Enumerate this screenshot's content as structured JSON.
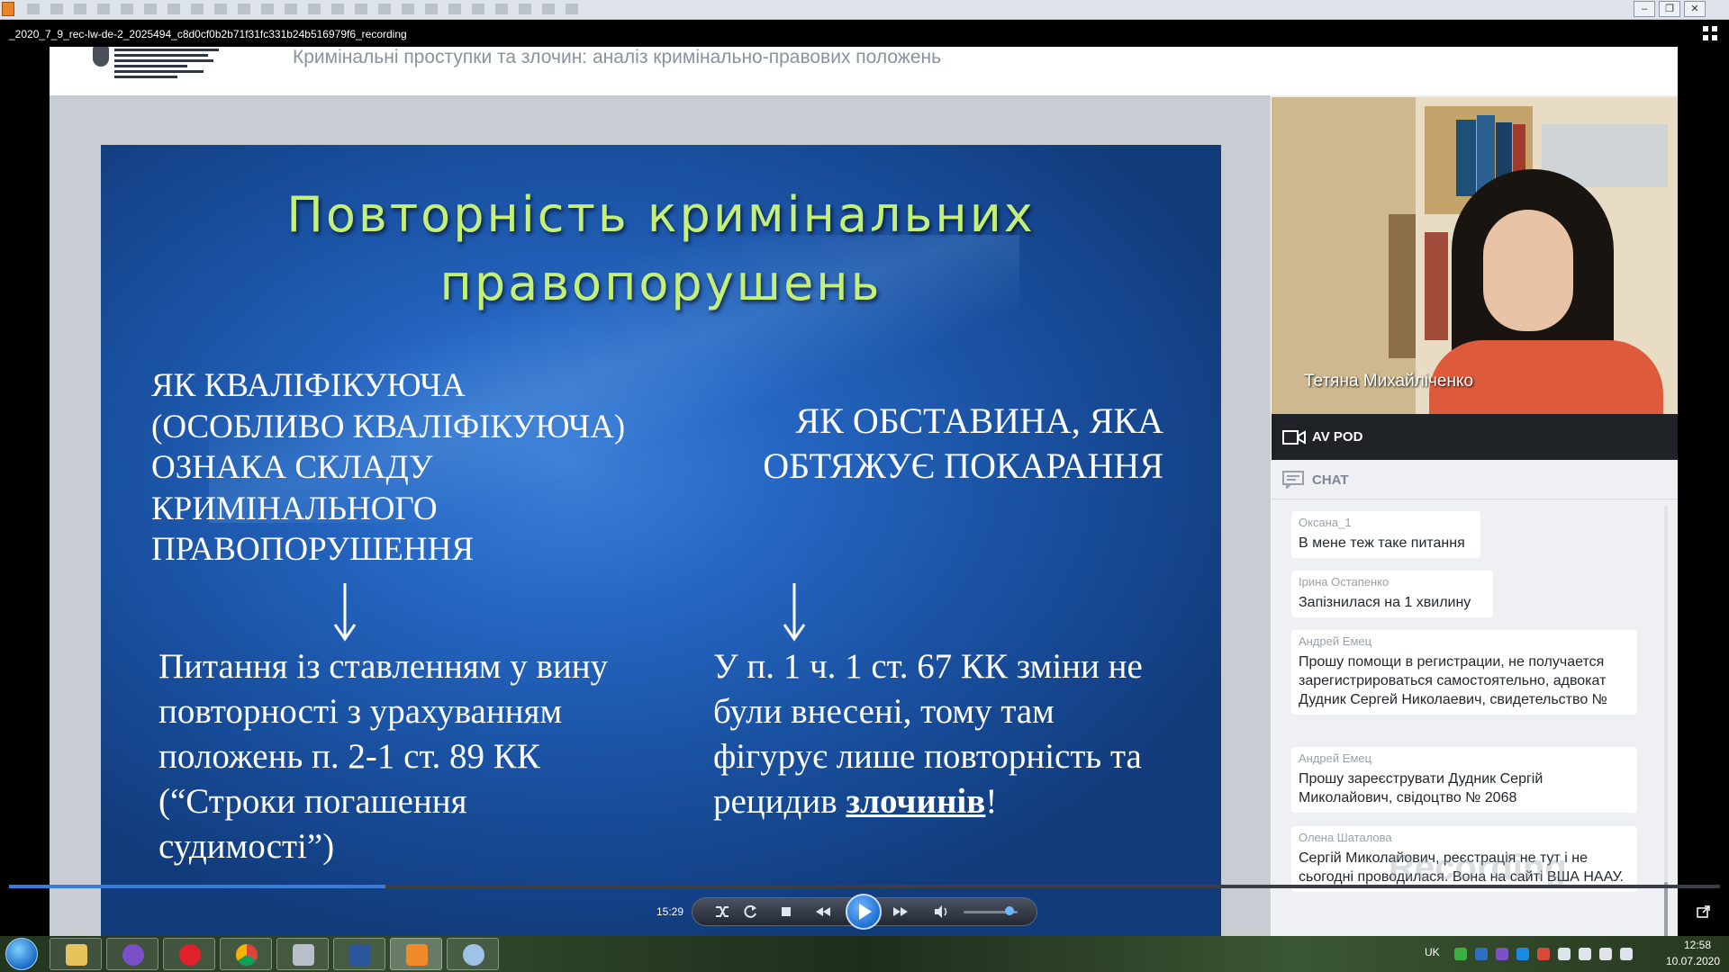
{
  "window": {
    "title": "_2020_7_9_rec-lw-de-2_2025494_c8d0cf0b2b71f31fc331b24b516979f6_recording",
    "minimize": "–",
    "restore": "❐",
    "close": "✕"
  },
  "recording": {
    "header_title": "Кримінальні проступки та злочин: аналіз кримінально-правових положень"
  },
  "slide": {
    "title_line1": "Повторність кримінальних",
    "title_line2": "правопорушень",
    "left_heading": [
      "ЯК КВАЛІФІКУЮЧА",
      "(ОСОБЛИВО КВАЛІФІКУЮЧА)",
      "ОЗНАКА СКЛАДУ",
      "КРИМІНАЛЬНОГО",
      "ПРАВОПОРУШЕННЯ"
    ],
    "right_heading": [
      "ЯК ОБСТАВИНА, ЯКА",
      "ОБТЯЖУЄ ПОКАРАННЯ"
    ],
    "arrow": "↓",
    "left_body": [
      "Питання із ставленням у вину",
      " повторності з урахуванням",
      " положень п. 2-1 ст. 89 КК",
      " (“Строки погашення",
      " судимості”)"
    ],
    "right_body": [
      "У п. 1 ч. 1 ст. 67 КК зміни не",
      "були внесені, тому там",
      "фігурує лише повторність та"
    ],
    "right_body_last_prefix": "рецидив ",
    "right_body_last_underlined": "злочинів",
    "right_body_last_suffix": "!"
  },
  "video": {
    "presenter_name": "Тетяна Михайліченко"
  },
  "pod": {
    "label": "AV POD"
  },
  "chat": {
    "label": "CHAT",
    "messages": [
      {
        "author": "Оксана_1",
        "text": "В мене теж таке питання"
      },
      {
        "author": "Ірина Остапенко",
        "text": "Запізнилася на 1 хвилину"
      },
      {
        "author": "Андрей Емец",
        "text": "Прошу помощи в регистрации, не получается зарегистрироваться самостоятельно, адвокат Дудник Сергей Николаевич, свидетельство №"
      },
      {
        "author": "Андрей Емец",
        "text": "Прошу зареєструвати Дудник Сергій Миколайович, свідоцтво № 2068"
      },
      {
        "author": "Олена Шаталова",
        "text": "Сергій Миколайович, реєстрація не тут і не сьогодні проводилася. Вона на сайті ВША НААУ."
      }
    ],
    "watermark": "Recording"
  },
  "player": {
    "time": "15:29",
    "progress": 0.22,
    "volume": 0.85,
    "play_icon": "play-icon"
  },
  "taskbar": {
    "items": [
      "explorer",
      "viber",
      "opera",
      "chrome",
      "scanner",
      "word",
      "media-player",
      "paint"
    ],
    "lang": "UK",
    "time": "12:58",
    "date": "10.07.2020"
  },
  "colors": {
    "slide_title": "#c4f07a",
    "slide_bg": "#2566c2",
    "player_accent": "#3a7bd5"
  }
}
